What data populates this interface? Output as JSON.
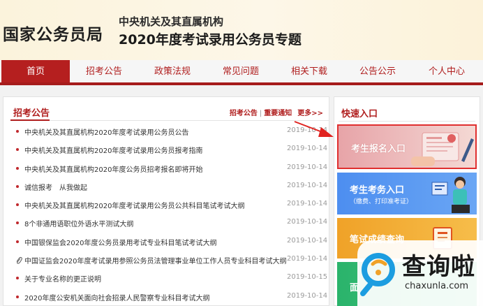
{
  "header": {
    "site_name": "国家公务员局",
    "subtitle_1": "中央机关及其直属机构",
    "subtitle_2": "2020年度考试录用公务员专题"
  },
  "nav": {
    "items": [
      {
        "label": "首页",
        "active": true
      },
      {
        "label": "招考公告"
      },
      {
        "label": "政策法规"
      },
      {
        "label": "常见问题"
      },
      {
        "label": "相关下载"
      },
      {
        "label": "公告公示"
      },
      {
        "label": "个人中心"
      }
    ]
  },
  "announcements": {
    "title": "招考公告",
    "link_1": "招考公告",
    "separator": "|",
    "link_2": "重要通知",
    "more": "更多>>",
    "items": [
      {
        "title": "中央机关及其直属机构2020年度考试录用公务员公告",
        "date": "2019-10-14"
      },
      {
        "title": "中央机关及其直属机构2020年度考试录用公务员报考指南",
        "date": "2019-10-14"
      },
      {
        "title": "中央机关及其直属机构2020年度公务员招考报名即将开始",
        "date": "2019-10-14"
      },
      {
        "title": "诚信报考　从我做起",
        "date": "2019-10-14"
      },
      {
        "title": "中央机关及其直属机构2020年度考试录用公务员公共科目笔试考试大纲",
        "date": "2019-10-14"
      },
      {
        "title": "8个非通用语职位外语水平测试大纲",
        "date": "2019-10-14"
      },
      {
        "title": "中国银保监会2020年度公务员录用考试专业科目笔试考试大纲",
        "date": "2019-10-14"
      },
      {
        "title": "中国证监会2020年度考试录用参照公务员法管理事业单位工作人员专业科目考试大纲",
        "date": "2019-10-14"
      },
      {
        "title": "关于专业名称的更正说明",
        "date": "2019-10-15"
      },
      {
        "title": "2020年度公安机关面向社会招录人民警察专业科目考试大纲",
        "date": "2019-10-14"
      }
    ]
  },
  "quick_entry": {
    "title": "快速入口",
    "cards": [
      {
        "label": "考生报名入口"
      },
      {
        "label": "考生考务入口",
        "sub": "（缴费、打印准考证）"
      },
      {
        "label": "笔试成绩查询"
      },
      {
        "label": "面"
      }
    ]
  },
  "watermark": {
    "text": "查询啦",
    "url": "chaxunla.com"
  },
  "colors": {
    "brand_red": "#b51f1f",
    "card_pink": "#e7a4a8",
    "card_blue": "#4d8ef0",
    "card_orange": "#f0a228",
    "card_green": "#2ab36b"
  }
}
